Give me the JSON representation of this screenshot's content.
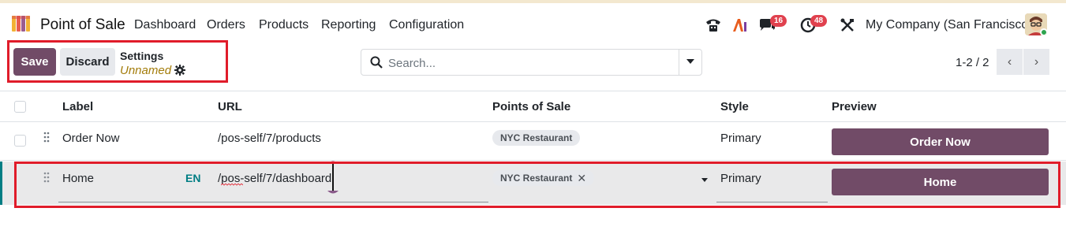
{
  "nav": {
    "app_title": "Point of Sale",
    "menu": [
      "Dashboard",
      "Orders",
      "Products",
      "Reporting",
      "Configuration"
    ],
    "messages_badge": "16",
    "activities_badge": "48",
    "company": "My Company (San Francisco)"
  },
  "control": {
    "save_label": "Save",
    "discard_label": "Discard",
    "breadcrumb_parent": "Settings",
    "breadcrumb_record": "Unnamed",
    "search_placeholder": "Search...",
    "pager": "1-2 / 2"
  },
  "table": {
    "columns": [
      "Label",
      "URL",
      "Points of Sale",
      "Style",
      "Preview"
    ],
    "rows": [
      {
        "label": "Order Now",
        "url": "/pos-self/7/products",
        "pos": "NYC Restaurant",
        "style": "Primary",
        "preview": "Order Now"
      },
      {
        "label": "Home",
        "lang": "EN",
        "url": "/pos-self/7/dashboard",
        "pos": "NYC Restaurant",
        "style": "Primary",
        "preview": "Home"
      }
    ]
  },
  "colors": {
    "brand": "#714b67",
    "highlight": "#e01c2a",
    "teal": "#017e84"
  }
}
